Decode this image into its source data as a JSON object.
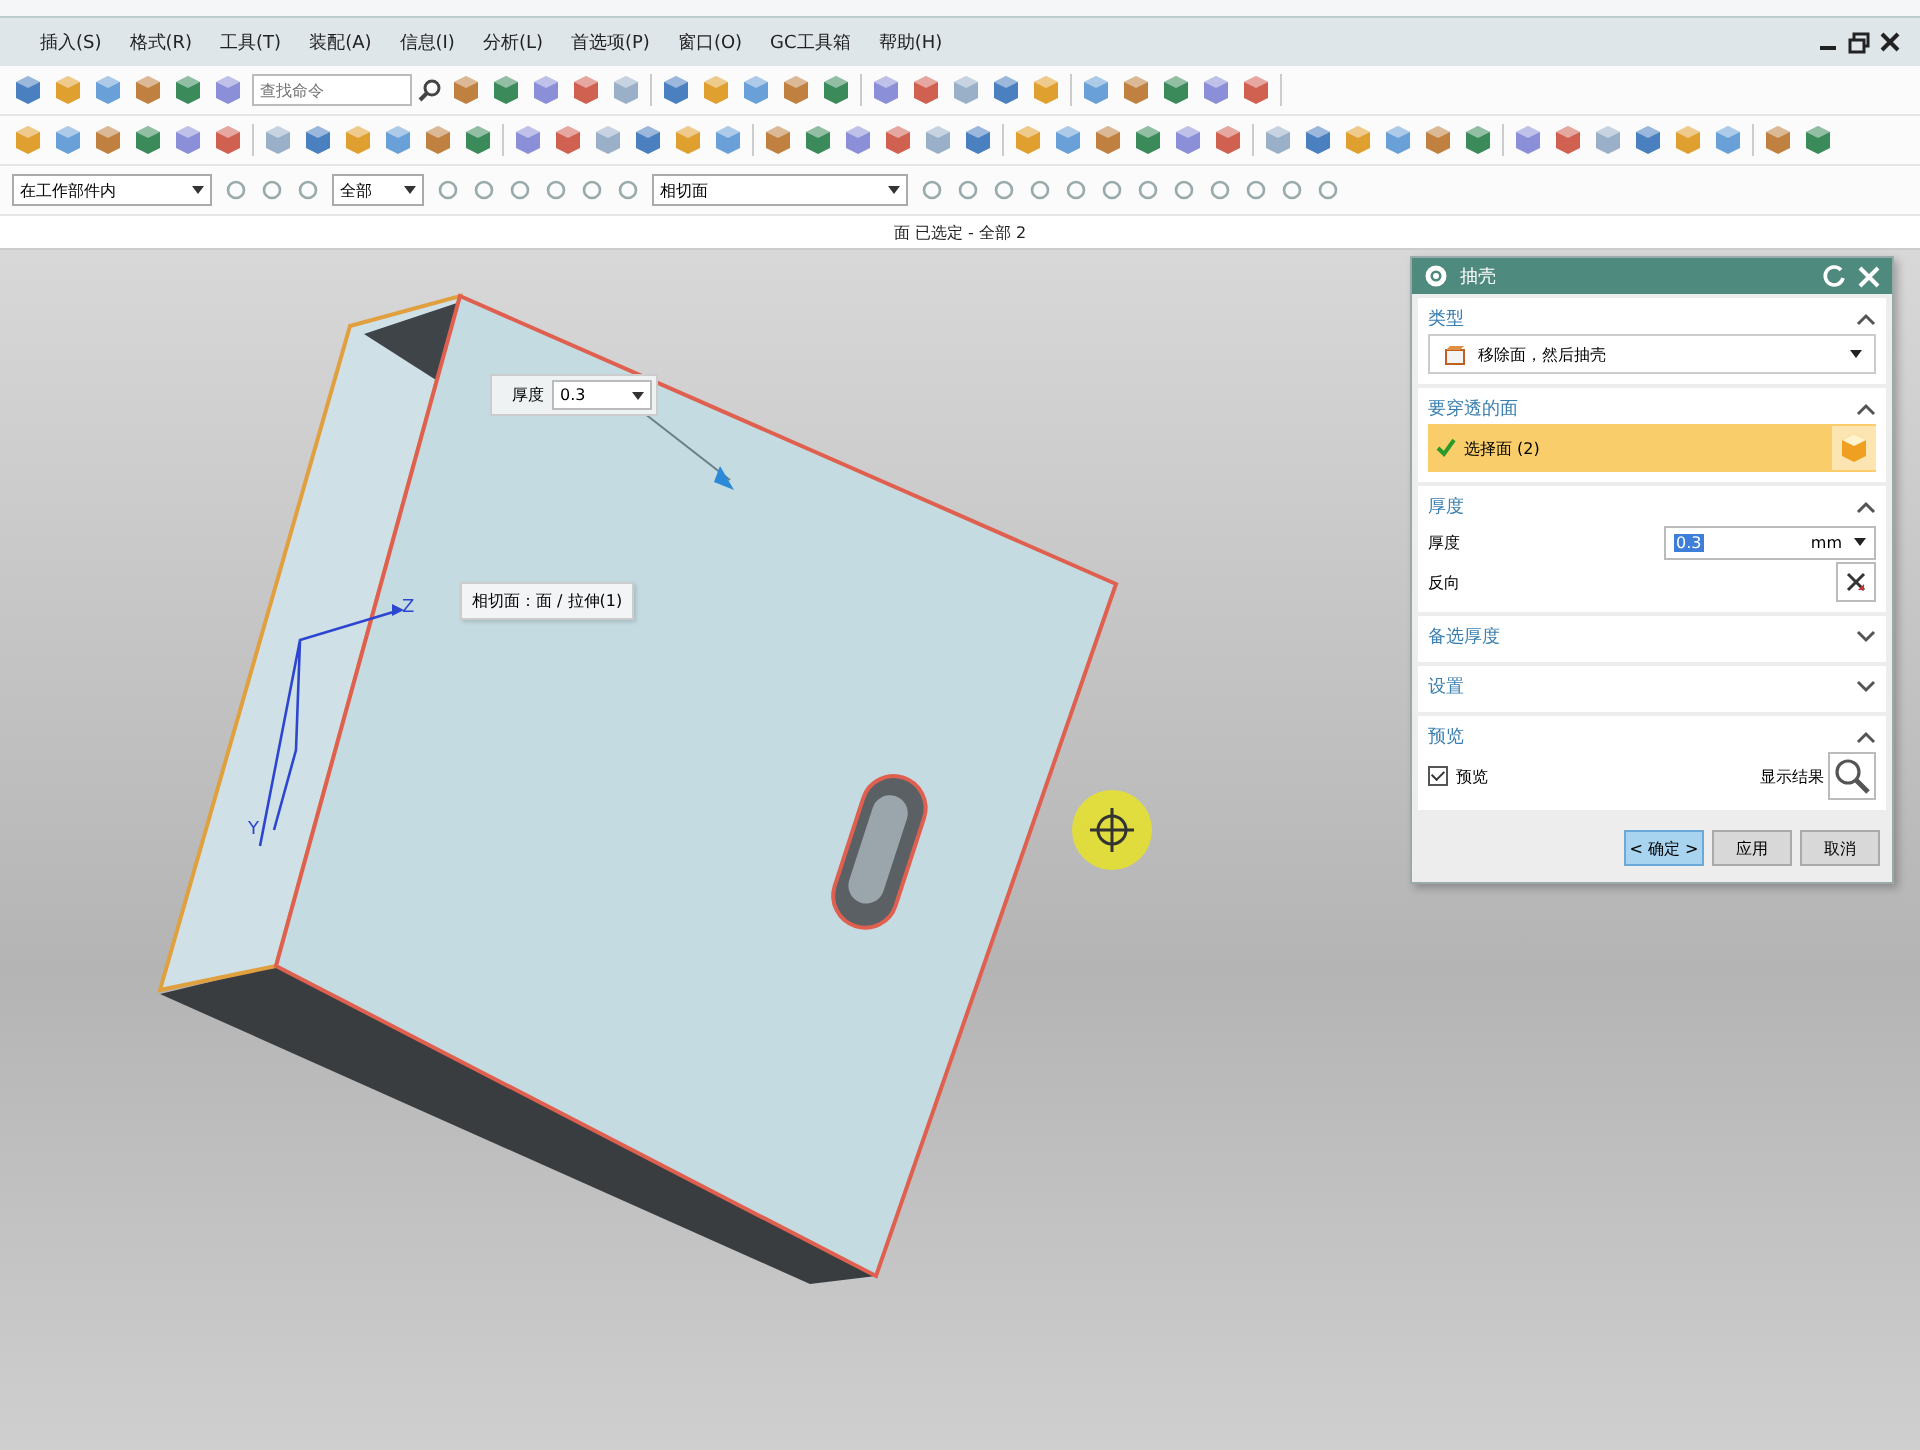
{
  "menu_bar": {
    "items": [
      "插入(S)",
      "格式(R)",
      "工具(T)",
      "装配(A)",
      "信息(I)",
      "分析(L)",
      "首选项(P)",
      "窗口(O)",
      "GC工具箱",
      "帮助(H)"
    ]
  },
  "toolbar": {
    "search": {
      "placeholder": "查找命令"
    },
    "filter_dropdowns": [
      {
        "value": "在工作部件内"
      },
      {
        "value": "全部"
      },
      {
        "value": "相切面"
      }
    ]
  },
  "status_bar": {
    "text": "面 已选定 - 全部 2"
  },
  "viewport": {
    "thickness_label": "厚度",
    "thickness_value": "0.3",
    "tooltip": "相切面：面 / 拉伸(1)",
    "axis_labels": [
      "Z",
      "Y"
    ]
  },
  "dialog": {
    "title": "抽壳",
    "sections": [
      {
        "title": "类型",
        "expanded": true,
        "rows": [
          {
            "kind": "dropdown",
            "value": "移除面，然后抽壳"
          }
        ]
      },
      {
        "title": "要穿透的面",
        "expanded": true,
        "rows": [
          {
            "kind": "selection",
            "label": "选择面 (2)",
            "selected": true
          }
        ]
      },
      {
        "title": "厚度",
        "expanded": true,
        "rows": [
          {
            "kind": "field",
            "label": "厚度",
            "value": "0.3",
            "unit": "mm"
          },
          {
            "kind": "toggle-button",
            "label": "反向"
          }
        ]
      },
      {
        "title": "备选厚度",
        "expanded": false
      },
      {
        "title": "设置",
        "expanded": false
      },
      {
        "title": "预览",
        "expanded": true,
        "rows": [
          {
            "kind": "checkbox",
            "label": "预览",
            "checked": true,
            "action_label": "显示结果"
          }
        ]
      }
    ],
    "buttons": [
      {
        "label": "< 确定 >",
        "default": true
      },
      {
        "label": "应用",
        "default": false
      },
      {
        "label": "取消",
        "default": false
      }
    ]
  }
}
